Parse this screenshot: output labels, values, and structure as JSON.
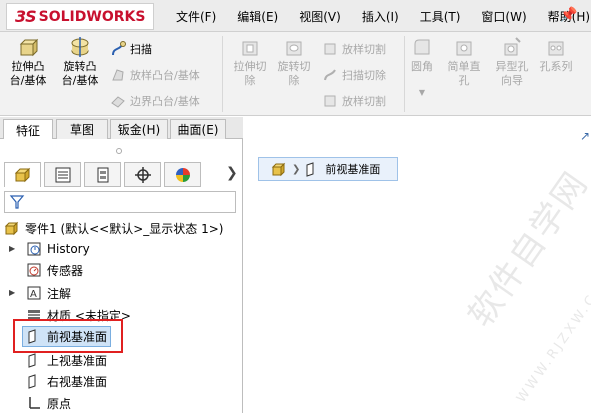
{
  "app": {
    "logo_ds": "3S",
    "logo_text": "SOLIDWORKS"
  },
  "menu": [
    "文件(F)",
    "编辑(E)",
    "视图(V)",
    "插入(I)",
    "工具(T)",
    "窗口(W)",
    "帮助(H)"
  ],
  "ribbon": {
    "extrude_boss": "拉伸凸\n台/基体",
    "revolve_boss": "旋转凸\n台/基体",
    "sweep": "扫描",
    "loft_boss": "放样凸台/基体",
    "boundary_boss": "边界凸台/基体",
    "extrude_cut": "拉伸切\n除",
    "revolve_cut": "旋转切\n除",
    "loft_cut": "放样切割",
    "sweep_cut": "扫描切除",
    "loft_cut2": "放样切割",
    "fillet": "圆角",
    "simple_hole": "简单直\n孔",
    "hole_wizard": "异型孔\n向导",
    "hole_series": "孔系列"
  },
  "tabs": [
    "特征",
    "草图",
    "钣金(H)",
    "曲面(E)"
  ],
  "tree": {
    "root": "零件1  (默认<<默认>_显示状态 1>)",
    "items": [
      "History",
      "传感器",
      "注解",
      "材质 <未指定>",
      "前视基准面",
      "上视基准面",
      "右视基准面",
      "原点"
    ]
  },
  "breadcrumb": {
    "label": "前视基准面"
  },
  "watermark": {
    "big": "软件自学网",
    "small": "WWW.RJZXW.COM"
  },
  "colors": {
    "brand_red": "#c8102e",
    "selection_blue": "#cfe3f7",
    "highlight_red": "#e02020"
  }
}
